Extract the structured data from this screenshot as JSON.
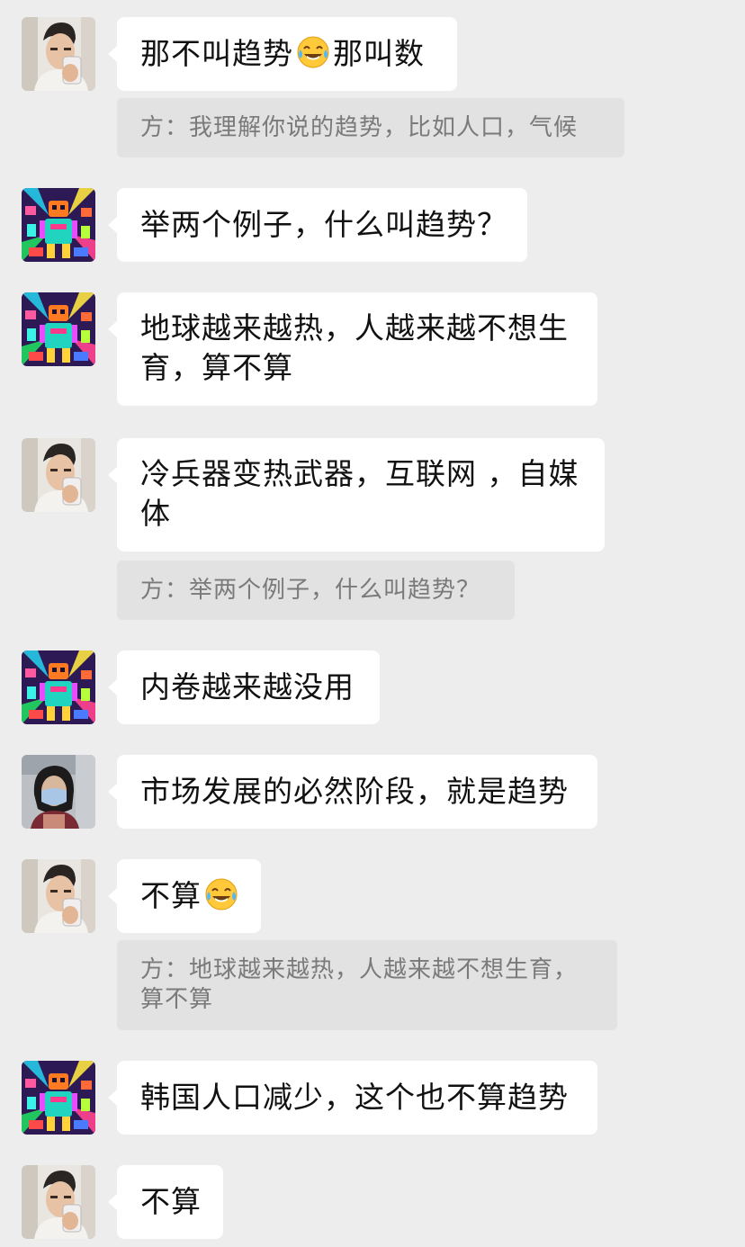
{
  "messages": [
    {
      "id": "m1",
      "avatar": "man-avatar",
      "parts": [
        "那不叫趋势",
        "emoji:laugh-cry",
        " 那叫数"
      ],
      "quote": "方：我理解你说的趋势，比如人口，气候"
    },
    {
      "id": "m2",
      "avatar": "robot-avatar",
      "text": "举两个例子，什么叫趋势？"
    },
    {
      "id": "m3",
      "avatar": "robot-avatar",
      "text": "地球越来越热，人越来越不想生育，算不算"
    },
    {
      "id": "m4",
      "avatar": "man-avatar",
      "text": "冷兵器变热武器，互联网 ，自媒体",
      "quote": "方：举两个例子，什么叫趋势？"
    },
    {
      "id": "m5",
      "avatar": "robot-avatar",
      "text": "内卷越来越没用"
    },
    {
      "id": "m6",
      "avatar": "woman-mask-avatar",
      "text": "市场发展的必然阶段，就是趋势"
    },
    {
      "id": "m7",
      "avatar": "man-avatar",
      "parts": [
        "不算",
        "emoji:laugh-cry"
      ],
      "quote": "方：地球越来越热，人越来越不想生育，算不算"
    },
    {
      "id": "m8",
      "avatar": "robot-avatar",
      "text": "韩国人口减少，这个也不算趋势"
    },
    {
      "id": "m9",
      "avatar": "man-avatar",
      "text": "不算"
    }
  ],
  "colors": {
    "background": "#ededed",
    "bubble": "#ffffff",
    "quote_bg": "#e2e2e2",
    "text": "#111111",
    "quote_text": "#7a7a7a"
  }
}
